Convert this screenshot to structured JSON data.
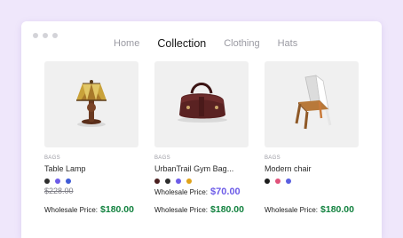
{
  "nav": {
    "items": [
      {
        "label": "Home",
        "active": false
      },
      {
        "label": "Collection",
        "active": true
      },
      {
        "label": "Clothing",
        "active": false
      },
      {
        "label": "Hats",
        "active": false
      }
    ]
  },
  "products": [
    {
      "category": "BAGS",
      "name": "Table Lamp",
      "image": "table-lamp-image",
      "swatches": [
        "#2d2d2d",
        "#6d5ce8",
        "#3f5bd6"
      ],
      "old_price": "$228.00",
      "wholesale_label": "Wholesale Price:",
      "wholesale_price": "$180.00"
    },
    {
      "category": "BAGS",
      "name": "UrbanTrail Gym Bag...",
      "image": "duffel-bag-image",
      "swatches": [
        "#4a1f1f",
        "#2d2d2d",
        "#6d5ce8",
        "#e0a21a"
      ],
      "promo_label": "Wholesale Price:",
      "promo_price": "$70.00",
      "wholesale_label": "Wholesale Price:",
      "wholesale_price": "$180.00"
    },
    {
      "category": "BAGS",
      "name": "Modern chair",
      "image": "modern-chair-image",
      "swatches": [
        "#1c1c1c",
        "#e0527a",
        "#5a5fe0"
      ],
      "wholesale_label": "Wholesale Price:",
      "wholesale_price": "$180.00"
    }
  ],
  "colors": {
    "background": "#efe7fb",
    "accent_purple": "#6d5ce8",
    "price_green": "#12823f"
  }
}
